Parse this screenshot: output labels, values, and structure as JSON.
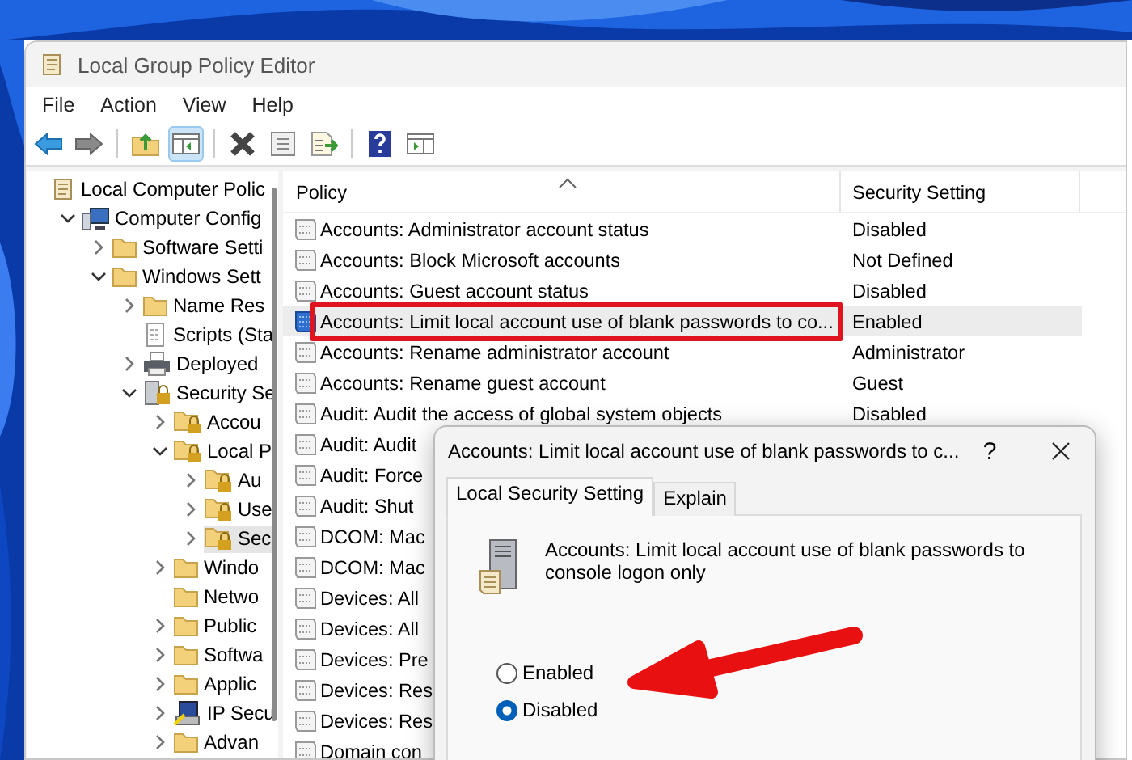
{
  "window": {
    "title": "Local Group Policy Editor"
  },
  "menu": [
    {
      "label": "File"
    },
    {
      "label": "Action"
    },
    {
      "label": "View"
    },
    {
      "label": "Help"
    }
  ],
  "toolbar": [
    {
      "kind": "back",
      "pressed": false
    },
    {
      "kind": "forward",
      "pressed": false
    },
    {
      "kind": "separator"
    },
    {
      "kind": "up",
      "pressed": false
    },
    {
      "kind": "tree",
      "pressed": true
    },
    {
      "kind": "separator"
    },
    {
      "kind": "delete",
      "pressed": false
    },
    {
      "kind": "properties",
      "pressed": false
    },
    {
      "kind": "export",
      "pressed": false
    },
    {
      "kind": "separator"
    },
    {
      "kind": "help",
      "pressed": false
    },
    {
      "kind": "pane",
      "pressed": false
    }
  ],
  "tree": [
    {
      "label": "Local Computer Polic",
      "kind": "policy",
      "expandable": false,
      "selected": false,
      "children": [
        {
          "label": "Computer Config",
          "kind": "computer",
          "expandable": true,
          "expanded": true,
          "selected": false,
          "children": [
            {
              "label": "Software Setti",
              "kind": "folder",
              "expandable": true,
              "expanded": false,
              "selected": false
            },
            {
              "label": "Windows Sett",
              "kind": "folder",
              "expandable": true,
              "expanded": true,
              "selected": false,
              "children": [
                {
                  "label": "Name Res",
                  "kind": "folder",
                  "expandable": true,
                  "expanded": false,
                  "selected": false
                },
                {
                  "label": "Scripts (Sta",
                  "kind": "script",
                  "expandable": false,
                  "selected": false
                },
                {
                  "label": "Deployed",
                  "kind": "printer",
                  "expandable": true,
                  "expanded": false,
                  "selected": false
                },
                {
                  "label": "Security Se",
                  "kind": "server",
                  "expandable": true,
                  "expanded": true,
                  "selected": false,
                  "children": [
                    {
                      "label": "Accou",
                      "kind": "lock-folder",
                      "expandable": true,
                      "expanded": false,
                      "selected": false
                    },
                    {
                      "label": "Local P",
                      "kind": "lock-folder",
                      "expandable": true,
                      "expanded": true,
                      "selected": false,
                      "children": [
                        {
                          "label": "Au",
                          "kind": "lock-folder",
                          "expandable": true,
                          "expanded": false,
                          "selected": false
                        },
                        {
                          "label": "Use",
                          "kind": "lock-folder",
                          "expandable": true,
                          "expanded": false,
                          "selected": false
                        },
                        {
                          "label": "Sec",
                          "kind": "lock-folder",
                          "expandable": true,
                          "expanded": false,
                          "selected": true
                        }
                      ]
                    },
                    {
                      "label": "Windo",
                      "kind": "folder",
                      "expandable": true,
                      "expanded": false,
                      "selected": false
                    },
                    {
                      "label": "Netwo",
                      "kind": "folder",
                      "expandable": false,
                      "selected": false
                    },
                    {
                      "label": "Public",
                      "kind": "folder",
                      "expandable": true,
                      "expanded": false,
                      "selected": false
                    },
                    {
                      "label": "Softwa",
                      "kind": "folder",
                      "expandable": true,
                      "expanded": false,
                      "selected": false
                    },
                    {
                      "label": "Applic",
                      "kind": "folder",
                      "expandable": true,
                      "expanded": false,
                      "selected": false
                    },
                    {
                      "label": "IP Secu",
                      "kind": "ip",
                      "expandable": true,
                      "expanded": false,
                      "selected": false
                    },
                    {
                      "label": "Advan",
                      "kind": "folder",
                      "expandable": true,
                      "expanded": false,
                      "selected": false
                    }
                  ]
                }
              ]
            }
          ]
        }
      ]
    }
  ],
  "list": {
    "columns": [
      {
        "label": "Policy"
      },
      {
        "label": "Security Setting"
      }
    ],
    "rows": [
      {
        "policy": "Accounts: Administrator account status",
        "setting": "Disabled",
        "selected": false,
        "framed": false
      },
      {
        "policy": "Accounts: Block Microsoft accounts",
        "setting": "Not Defined",
        "selected": false,
        "framed": false
      },
      {
        "policy": "Accounts: Guest account status",
        "setting": "Disabled",
        "selected": false,
        "framed": false
      },
      {
        "policy": "Accounts: Limit local account use of blank passwords to co...",
        "setting": "Enabled",
        "selected": true,
        "framed": true
      },
      {
        "policy": "Accounts: Rename administrator account",
        "setting": "Administrator",
        "selected": false,
        "framed": false
      },
      {
        "policy": "Accounts: Rename guest account",
        "setting": "Guest",
        "selected": false,
        "framed": false
      },
      {
        "policy": "Audit: Audit the access of global system objects",
        "setting": "Disabled",
        "selected": false,
        "framed": false
      },
      {
        "policy": "Audit: Audit",
        "selected": false,
        "framed": false
      },
      {
        "policy": "Audit: Force",
        "selected": false,
        "framed": false
      },
      {
        "policy": "Audit: Shut",
        "selected": false,
        "framed": false
      },
      {
        "policy": "DCOM: Mac",
        "selected": false,
        "framed": false
      },
      {
        "policy": "DCOM: Mac",
        "selected": false,
        "framed": false
      },
      {
        "policy": "Devices: All",
        "selected": false,
        "framed": false
      },
      {
        "policy": "Devices: All",
        "selected": false,
        "framed": false
      },
      {
        "policy": "Devices: Pre",
        "selected": false,
        "framed": false
      },
      {
        "policy": "Devices: Res",
        "selected": false,
        "framed": false
      },
      {
        "policy": "Devices: Res",
        "selected": false,
        "framed": false
      },
      {
        "policy": "Domain con",
        "selected": false,
        "framed": false
      }
    ]
  },
  "dialog": {
    "title": "Accounts: Limit local account use of blank passwords to c...",
    "help": "?",
    "tabs": [
      {
        "label": "Local Security Setting",
        "selected": true
      },
      {
        "label": "Explain",
        "selected": false
      }
    ],
    "description": "Accounts: Limit local account use of blank passwords to console logon only",
    "options": [
      {
        "label": "Enabled",
        "selected": false
      },
      {
        "label": "Disabled",
        "selected": true
      }
    ]
  }
}
